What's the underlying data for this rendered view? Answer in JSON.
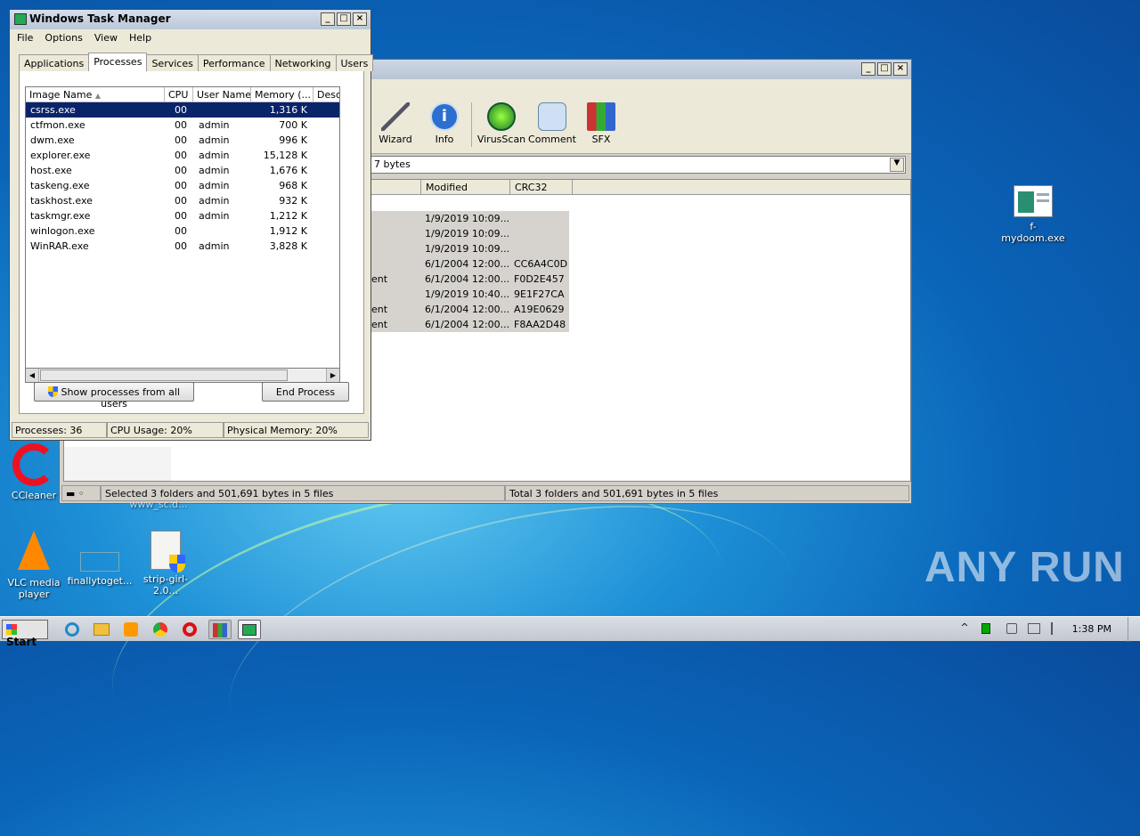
{
  "desktop": {
    "icons": [
      {
        "label": "f-mydoom.exe",
        "icon": "exe-file-icon"
      },
      {
        "label": "CCleaner",
        "icon": "ccleaner-icon"
      },
      {
        "label": "VLC media player",
        "icon": "vlc-icon"
      },
      {
        "label": "finallytoget...",
        "icon": "file-icon"
      },
      {
        "label": "strip-girl-2.0...",
        "icon": "installer-icon"
      },
      {
        "label": "www_sc.d...",
        "icon": "file-icon"
      }
    ],
    "watermark": "ANY RUN"
  },
  "winrar": {
    "toolbar": [
      {
        "label": "Wizard",
        "icon": "wizard-icon"
      },
      {
        "label": "Info",
        "icon": "info-icon"
      },
      {
        "label": "VirusScan",
        "icon": "virusscan-icon"
      },
      {
        "label": "Comment",
        "icon": "comment-icon"
      },
      {
        "label": "SFX",
        "icon": "sfx-icon"
      }
    ],
    "path_value": "7 bytes",
    "columns": [
      "Modified",
      "CRC32"
    ],
    "rows": [
      {
        "type": "",
        "modified": "1/9/2019 10:09...",
        "crc": ""
      },
      {
        "type": "",
        "modified": "1/9/2019 10:09...",
        "crc": ""
      },
      {
        "type": "",
        "modified": "1/9/2019 10:09...",
        "crc": ""
      },
      {
        "type": "",
        "modified": "6/1/2004 12:00...",
        "crc": "CC6A4C0D"
      },
      {
        "type": "ent",
        "modified": "6/1/2004 12:00...",
        "crc": "F0D2E457"
      },
      {
        "type": "",
        "modified": "1/9/2019 10:40...",
        "crc": "9E1F27CA"
      },
      {
        "type": "ent",
        "modified": "6/1/2004 12:00...",
        "crc": "A19E0629"
      },
      {
        "type": "ent",
        "modified": "6/1/2004 12:00...",
        "crc": "F8AA2D48"
      }
    ],
    "status_left": "Selected 3 folders and 501,691 bytes in 5 files",
    "status_right": "Total 3 folders and 501,691 bytes in 5 files"
  },
  "taskmgr": {
    "title": "Windows Task Manager",
    "menu": [
      "File",
      "Options",
      "View",
      "Help"
    ],
    "tabs": [
      "Applications",
      "Processes",
      "Services",
      "Performance",
      "Networking",
      "Users"
    ],
    "active_tab": "Processes",
    "columns": [
      "Image Name",
      "CPU",
      "User Name",
      "Memory (...",
      "Desc"
    ],
    "processes": [
      {
        "name": "csrss.exe",
        "cpu": "00",
        "user": "",
        "mem": "1,316 K",
        "selected": true
      },
      {
        "name": "ctfmon.exe",
        "cpu": "00",
        "user": "admin",
        "mem": "700 K"
      },
      {
        "name": "dwm.exe",
        "cpu": "00",
        "user": "admin",
        "mem": "996 K"
      },
      {
        "name": "explorer.exe",
        "cpu": "00",
        "user": "admin",
        "mem": "15,128 K"
      },
      {
        "name": "host.exe",
        "cpu": "00",
        "user": "admin",
        "mem": "1,676 K"
      },
      {
        "name": "taskeng.exe",
        "cpu": "00",
        "user": "admin",
        "mem": "968 K"
      },
      {
        "name": "taskhost.exe",
        "cpu": "00",
        "user": "admin",
        "mem": "932 K"
      },
      {
        "name": "taskmgr.exe",
        "cpu": "00",
        "user": "admin",
        "mem": "1,212 K"
      },
      {
        "name": "winlogon.exe",
        "cpu": "00",
        "user": "",
        "mem": "1,912 K"
      },
      {
        "name": "WinRAR.exe",
        "cpu": "00",
        "user": "admin",
        "mem": "3,828 K"
      }
    ],
    "show_all_label": "Show processes from all users",
    "end_process_label": "End Process",
    "status": {
      "processes": "Processes: 36",
      "cpu": "CPU Usage: 20%",
      "memory": "Physical Memory: 20%"
    }
  },
  "taskbar": {
    "start_label": "Start",
    "clock": "1:38 PM"
  }
}
